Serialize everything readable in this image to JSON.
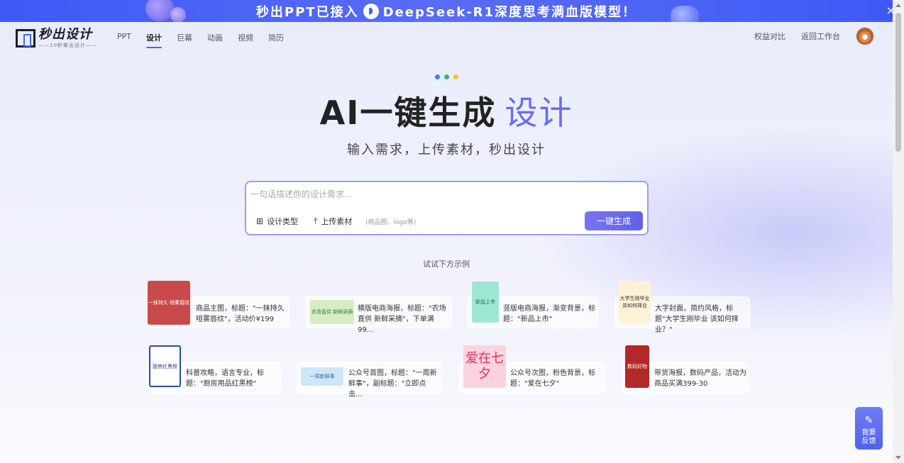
{
  "banner": {
    "text_before": "秒出PPT已接入",
    "text_after": "DeepSeek-R1深度思考满血版模型！",
    "icon": "deepseek-logo-icon",
    "close": "×"
  },
  "header": {
    "logo_title": "秒出设计",
    "logo_sub": "——10秒做出设计——",
    "nav": [
      "PPT",
      "设计",
      "巨幕",
      "动画",
      "视频",
      "简历"
    ],
    "active_nav": "设计",
    "links": [
      "权益对比",
      "返回工作台"
    ]
  },
  "hero": {
    "dot_colors": [
      "#4a7cf5",
      "#3cb371",
      "#f5c518"
    ],
    "title_main": "AI一键生成",
    "title_accent": "设计",
    "subtitle": "输入需求，上传素材，秒出设计"
  },
  "input": {
    "placeholder": "一句话描述你的设计需求...",
    "value": "",
    "type_label": "设计类型",
    "type_icon": "grid-icon",
    "upload_label": "上传素材",
    "upload_icon": "upload-icon",
    "upload_hint": "(商品图、logo等)",
    "generate_label": "一键生成"
  },
  "examples_label": "试试下方示例",
  "examples": [
    {
      "text": "商品主图，标题：\"一抹持久 哑雾唇纹\"，活动价¥199",
      "thumb": {
        "bg": "#c84a4a",
        "caption": "一抹持久 哑雾唇纹"
      }
    },
    {
      "text": "横版电商海报，标题：\"农场直供 新鲜采摘\"，下单满99...",
      "thumb": {
        "bg": "#d7ecc4",
        "caption": "农场直供 新鲜采摘"
      }
    },
    {
      "text": "竖版电商海报，渐变背景，标题：\"新品上市\"",
      "thumb": {
        "bg": "#9ee6d4",
        "caption": "新品上市"
      }
    },
    {
      "text": "大字封面，简约风格，标题\"大学生刚毕业 该如何择业？\"",
      "thumb": {
        "bg": "#fdf2d6",
        "caption": "大学生刚毕业 该如何择业"
      }
    },
    {
      "text": "科普攻略，语言专业，标题：\"厨房用品红黑榜\"",
      "thumb": {
        "bg": "#ffffff",
        "caption": "厨房红黑榜"
      }
    },
    {
      "text": "公众号首图，标题：\"一周新鲜事\"，副标题：\"立即点击...",
      "thumb": {
        "bg": "#cfe6f8",
        "caption": "一周新鲜事"
      }
    },
    {
      "text": "公众号次图，粉色背景，标题：\"爱在七夕\"",
      "thumb": {
        "bg": "#fbd3de",
        "caption": "爱在七夕"
      }
    },
    {
      "text": "带货海报，数码产品，活动为商品买满399-30",
      "thumb": {
        "bg": "#b32828",
        "caption": "数码好物"
      }
    }
  ],
  "feedback": {
    "label": "我要反馈",
    "icon": "feedback-pen-icon"
  }
}
